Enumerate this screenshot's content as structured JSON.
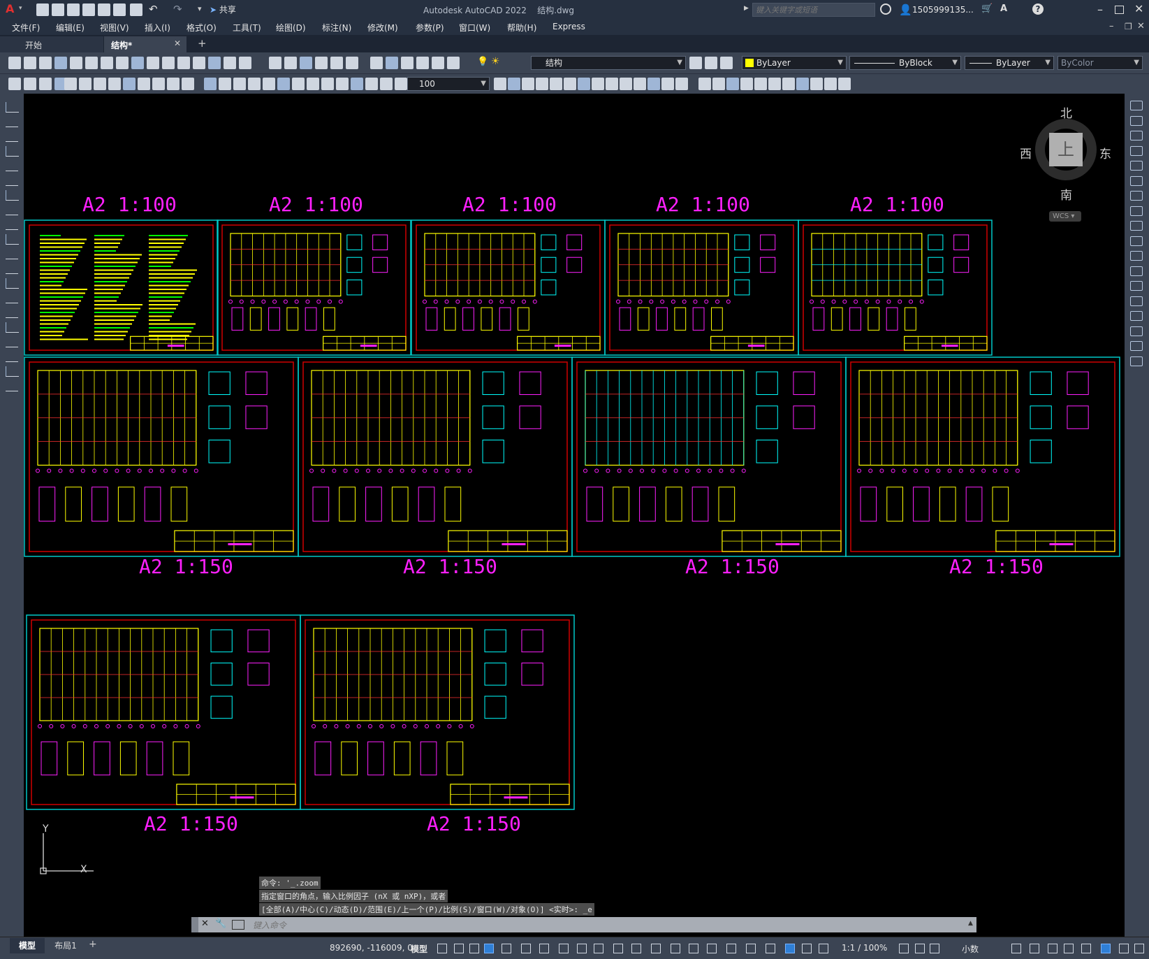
{
  "app": {
    "title": "Autodesk AutoCAD 2022",
    "filename": "结构.dwg",
    "search_placeholder": "键入关键字或短语",
    "user": "1505999135...",
    "share_label": "共享"
  },
  "menu": [
    "文件(F)",
    "编辑(E)",
    "视图(V)",
    "插入(I)",
    "格式(O)",
    "工具(T)",
    "绘图(D)",
    "标注(N)",
    "修改(M)",
    "参数(P)",
    "窗口(W)",
    "帮助(H)",
    "Express"
  ],
  "tabs": [
    {
      "label": "开始"
    },
    {
      "label": "结构*"
    }
  ],
  "layer_combo": "结构",
  "color_combo": "ByLayer",
  "linetype_combo": "ByBlock",
  "lineweight_combo": "ByLayer",
  "plotstyle_combo": "ByColor",
  "dimscale_combo": "100",
  "viewcube": {
    "north": "北",
    "south": "南",
    "east": "东",
    "west": "西",
    "face": "上",
    "wcs": "WCS"
  },
  "sheet_labels": {
    "row1": [
      "A2 1:100",
      "A2 1:100",
      "A2 1:100",
      "A2 1:100",
      "A2 1:100"
    ],
    "row2": [
      "A2 1:150",
      "A2 1:150",
      "A2 1:150",
      "A2 1:150"
    ],
    "row3": [
      "A2 1:150",
      "A2 1:150"
    ]
  },
  "ucs": {
    "x": "X",
    "y": "Y"
  },
  "command_history": [
    "命令: '_.zoom",
    "指定窗口的角点，输入比例因子 (nX 或 nXP)，或者",
    "[全部(A)/中心(C)/动态(D)/范围(E)/上一个(P)/比例(S)/窗口(W)/对象(O)] <实时>: _e"
  ],
  "command_placeholder": "键入命令",
  "layout_tabs": [
    "模型",
    "布局1"
  ],
  "status": {
    "coords": "892690, -116009, 0",
    "model": "模型",
    "annoscale": "1:1 / 100%",
    "units": "小数"
  },
  "colors": {
    "sheet_border": "#00c8c8",
    "frame": "#d00000",
    "label": "#ff20ff",
    "ui_bg": "#3b4453"
  }
}
